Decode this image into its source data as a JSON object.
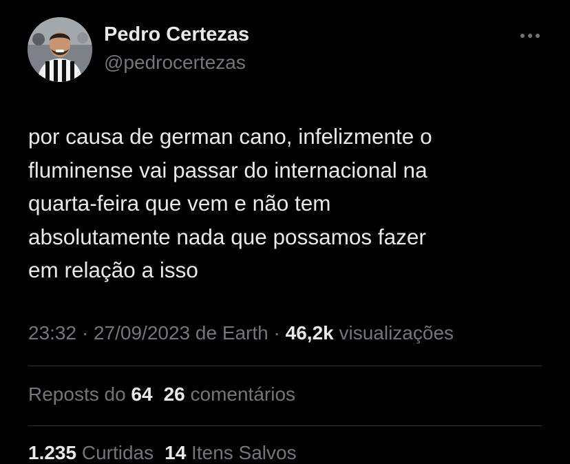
{
  "author": {
    "name": "Pedro Certezas",
    "handle": "@pedrocertezas"
  },
  "more_icon": "more-horizontal-icon",
  "tweet": {
    "text": "por causa de german cano, infelizmente o\nfluminense vai passar do internacional na\nquarta-feira que vem e não tem\nabsolutamente nada que possamos fazer\nem relação a isso"
  },
  "meta": {
    "time": "23:32",
    "sep1": " · ",
    "date": "27/09/2023",
    "source": " de Earth",
    "sep2": " · ",
    "views_count": "46,2k",
    "views_label": " visualizações"
  },
  "engagement": {
    "reposts_label": "Reposts do ",
    "reposts_count": "64",
    "comments_count": "26",
    "comments_label": " comentários",
    "likes_count": "1.235",
    "likes_label": " Curtidas",
    "saves_count": "14",
    "saves_label": " Itens Salvos"
  },
  "colors": {
    "background": "#000000",
    "primary_text": "#e7e9ea",
    "secondary_text": "#71767b",
    "divider": "#2f3336"
  }
}
